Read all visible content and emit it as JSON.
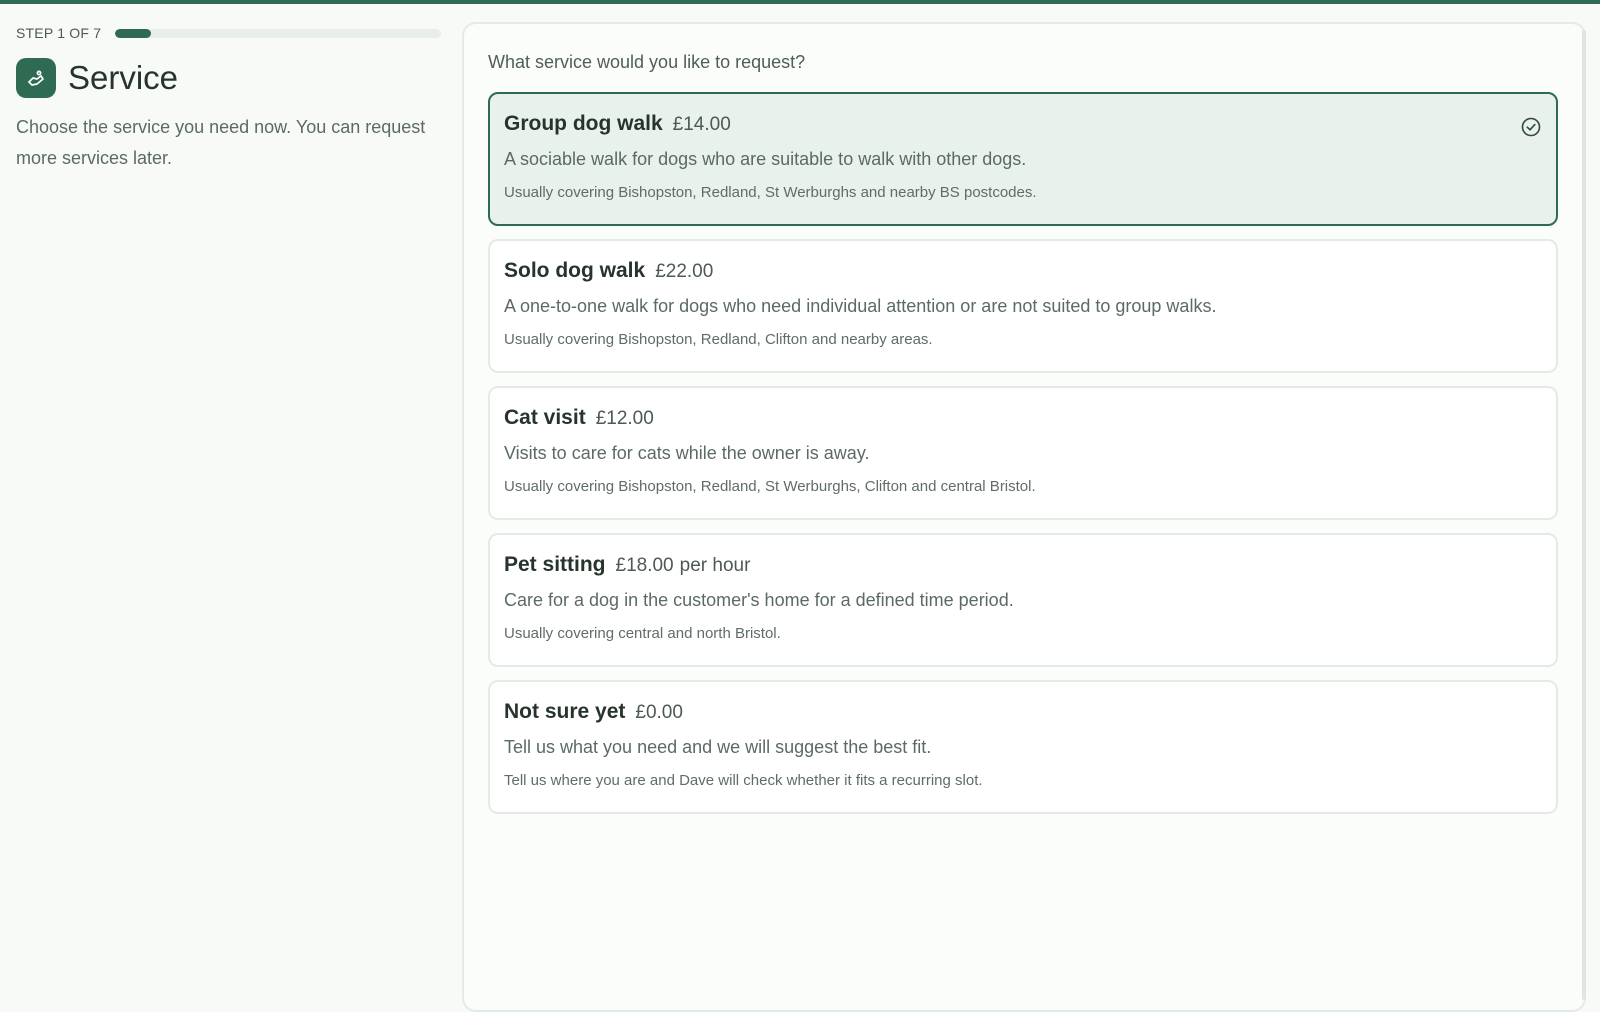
{
  "step": {
    "label": "STEP 1 OF 7",
    "current": 1,
    "total": 7,
    "progress_fraction": 0.11
  },
  "header": {
    "icon": "paw-hand-icon",
    "title": "Service",
    "description": "Choose the service you need now. You can request more services later."
  },
  "question": "What service would you like to request?",
  "options": [
    {
      "name": "Group dog walk",
      "price": "£14.00",
      "unit": "",
      "description": "A sociable walk for dogs who are suitable to walk with other dogs.",
      "area": "Usually covering Bishopston, Redland, St Werburghs and nearby BS postcodes.",
      "selected": true
    },
    {
      "name": "Solo dog walk",
      "price": "£22.00",
      "unit": "",
      "description": "A one-to-one walk for dogs who need individual attention or are not suited to group walks.",
      "area": "Usually covering Bishopston, Redland, Clifton and nearby areas.",
      "selected": false
    },
    {
      "name": "Cat visit",
      "price": "£12.00",
      "unit": "",
      "description": "Visits to care for cats while the owner is away.",
      "area": "Usually covering Bishopston, Redland, St Werburghs, Clifton and central Bristol.",
      "selected": false
    },
    {
      "name": "Pet sitting",
      "price": "£18.00",
      "unit": "per hour",
      "description": "Care for a dog in the customer's home for a defined time period.",
      "area": "Usually covering central and north Bristol.",
      "selected": false
    },
    {
      "name": "Not sure yet",
      "price": "£0.00",
      "unit": "",
      "description": "Tell us what you need and we will suggest the best fit.",
      "area": "Tell us where you are and Dave will check whether it fits a recurring slot.",
      "selected": false
    }
  ],
  "colors": {
    "accent": "#2f6b52",
    "selected_bg": "#e8f1eb",
    "background": "#f7faf7"
  },
  "icons": {
    "selected_check": "check-circle-icon"
  }
}
